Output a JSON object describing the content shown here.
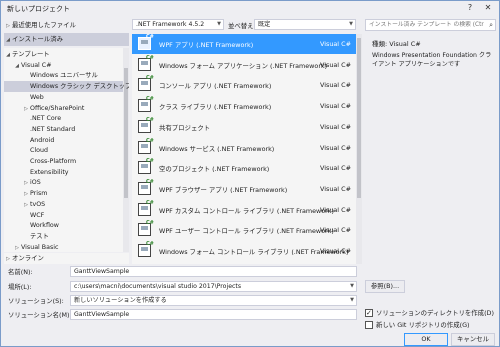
{
  "window": {
    "title": "新しいプロジェクト",
    "help_glyph": "?",
    "close_glyph": "✕"
  },
  "left": {
    "recent": "最近使用したファイル",
    "installed": "インストール済み",
    "online": "オンライン",
    "tree": [
      {
        "label": "テンプレート",
        "indent": 1,
        "arrow": "◢"
      },
      {
        "label": "Visual C#",
        "indent": 2,
        "arrow": "◢"
      },
      {
        "label": "Windows ユニバーサル",
        "indent": 3,
        "arrow": ""
      },
      {
        "label": "Windows クラシック デスクトップ",
        "indent": 3,
        "arrow": "",
        "selected": true
      },
      {
        "label": "Web",
        "indent": 3,
        "arrow": ""
      },
      {
        "label": "Office/SharePoint",
        "indent": 3,
        "arrow": "▷"
      },
      {
        "label": ".NET Core",
        "indent": 3,
        "arrow": ""
      },
      {
        "label": ".NET Standard",
        "indent": 3,
        "arrow": ""
      },
      {
        "label": "Android",
        "indent": 3,
        "arrow": ""
      },
      {
        "label": "Cloud",
        "indent": 3,
        "arrow": ""
      },
      {
        "label": "Cross-Platform",
        "indent": 3,
        "arrow": ""
      },
      {
        "label": "Extensibility",
        "indent": 3,
        "arrow": ""
      },
      {
        "label": "iOS",
        "indent": 3,
        "arrow": "▷"
      },
      {
        "label": "Prism",
        "indent": 3,
        "arrow": "▷"
      },
      {
        "label": "tvOS",
        "indent": 3,
        "arrow": "▷"
      },
      {
        "label": "WCF",
        "indent": 3,
        "arrow": ""
      },
      {
        "label": "Workflow",
        "indent": 3,
        "arrow": ""
      },
      {
        "label": "テスト",
        "indent": 3,
        "arrow": ""
      },
      {
        "label": "Visual Basic",
        "indent": 2,
        "arrow": "▷"
      }
    ]
  },
  "filter": {
    "framework": ".NET Framework 4.5.2",
    "sort_label": "並べ替え:",
    "sort_value": "既定"
  },
  "search": {
    "placeholder": "インストール済み テンプレート の検索 (Ctrl+E)"
  },
  "templates": [
    {
      "name": "WPF アプリ (.NET Framework)",
      "lang": "Visual C#",
      "selected": true
    },
    {
      "name": "Windows フォーム アプリケーション (.NET Framework)",
      "lang": "Visual C#"
    },
    {
      "name": "コンソール アプリ (.NET Framework)",
      "lang": "Visual C#"
    },
    {
      "name": "クラス ライブラリ (.NET Framework)",
      "lang": "Visual C#"
    },
    {
      "name": "共有プロジェクト",
      "lang": "Visual C#"
    },
    {
      "name": "Windows サービス (.NET Framework)",
      "lang": "Visual C#"
    },
    {
      "name": "空のプロジェクト (.NET Framework)",
      "lang": "Visual C#"
    },
    {
      "name": "WPF ブラウザー アプリ (.NET Framework)",
      "lang": "Visual C#"
    },
    {
      "name": "WPF カスタム コントロール ライブラリ (.NET Framework)",
      "lang": "Visual C#"
    },
    {
      "name": "WPF ユーザー コントロール ライブラリ (.NET Framework)",
      "lang": "Visual C#"
    },
    {
      "name": "Windows フォーム コントロール ライブラリ (.NET Framework)",
      "lang": "Visual C#"
    }
  ],
  "icon_badge": "C#",
  "info": {
    "kind": "種類: Visual C#",
    "description": "Windows Presentation Foundation クライアント アプリケーションです"
  },
  "form": {
    "name_label": "名前(N):",
    "name_value": "GanttViewSample",
    "location_label": "場所(L):",
    "location_value": "c:\\users\\macni\\documents\\visual studio 2017\\Projects",
    "solution_label": "ソリューション(S):",
    "solution_value": "新しいソリューションを作成する",
    "solution_name_label": "ソリューション名(M):",
    "solution_name_value": "GanttViewSample",
    "browse": "参照(B)...",
    "create_dir": "ソリューションのディレクトリを作成(D)",
    "create_dir_checked": true,
    "git": "新しい Git リポジトリの作成(G)",
    "git_checked": false,
    "ok": "OK",
    "cancel": "キャンセル"
  }
}
